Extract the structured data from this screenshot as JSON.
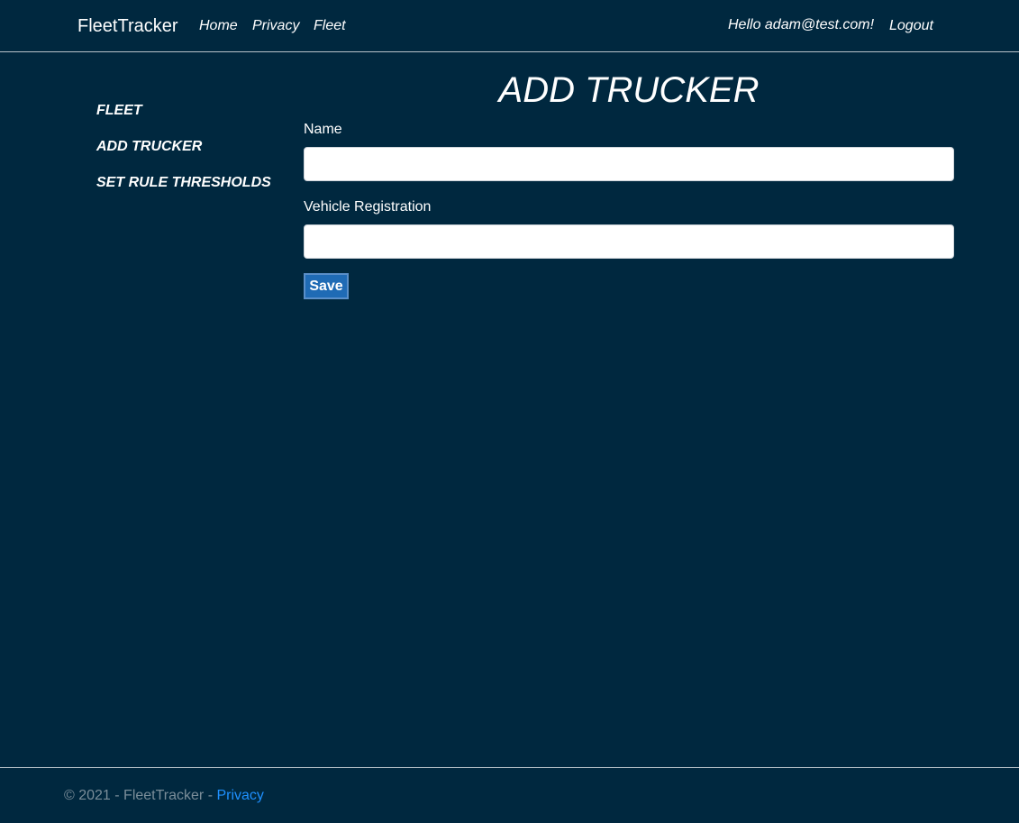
{
  "header": {
    "brand": "FleetTracker",
    "nav": {
      "home": "Home",
      "privacy": "Privacy",
      "fleet": "Fleet"
    },
    "greeting": "Hello adam@test.com!",
    "logout": "Logout"
  },
  "sidebar": {
    "items": [
      {
        "label": "FLEET"
      },
      {
        "label": "ADD TRUCKER"
      },
      {
        "label": "SET RULE THRESHOLDS"
      }
    ]
  },
  "main": {
    "title": "ADD TRUCKER",
    "form": {
      "name_label": "Name",
      "name_value": "",
      "registration_label": "Vehicle Registration",
      "registration_value": "",
      "save_label": "Save"
    }
  },
  "footer": {
    "copyright": "© 2021 - FleetTracker - ",
    "privacy_link": "Privacy"
  },
  "colors": {
    "background": "#00283f",
    "button": "#1f6bb5",
    "link": "#1e90ff",
    "footer_text": "#7a8d99"
  }
}
